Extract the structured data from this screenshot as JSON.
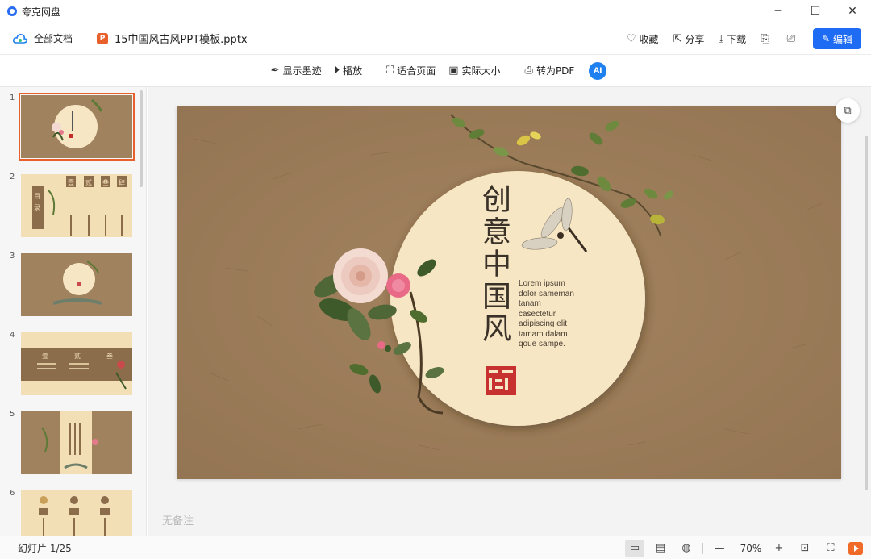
{
  "window": {
    "app_title": "夸克网盘",
    "minimize": "─",
    "maximize": "☐",
    "close": "✕"
  },
  "toolbar": {
    "all_docs_label": "全部文档",
    "ppt_badge": "P",
    "doc_name": "15中国风古风PPT模板.pptx",
    "favorite_label": "收藏",
    "share_label": "分享",
    "download_label": "下载",
    "edit_label": "编辑"
  },
  "viewbar": {
    "ink_label": "显示墨迹",
    "play_label": "播放",
    "fit_label": "适合页面",
    "actual_label": "实际大小",
    "pdf_label": "转为PDF",
    "ai_label": "AI"
  },
  "thumbnails": [
    {
      "num": "1"
    },
    {
      "num": "2"
    },
    {
      "num": "3"
    },
    {
      "num": "4"
    },
    {
      "num": "5"
    },
    {
      "num": "6"
    }
  ],
  "slide": {
    "title": "创意中国风",
    "body_lines": [
      "Lorem ipsum",
      "dolor sameman",
      "tanam",
      "casectetur",
      "adipiscing elit",
      "tamam dalam",
      "qoue sampe."
    ]
  },
  "thumb_texts": {
    "t2_mulu": "目录",
    "t2_cols": [
      "壹",
      "贰",
      "叁",
      "肆"
    ],
    "t4_cols": [
      "壹",
      "贰",
      "叁"
    ]
  },
  "notes_placeholder": "无备注",
  "status": {
    "slide_count": "幻灯片 1/25",
    "zoom": "70%"
  },
  "colors": {
    "accent": "#1f6cf4",
    "kraft": "#9b7d5a",
    "cream": "#f6e6c4",
    "selection": "#e8612c"
  }
}
